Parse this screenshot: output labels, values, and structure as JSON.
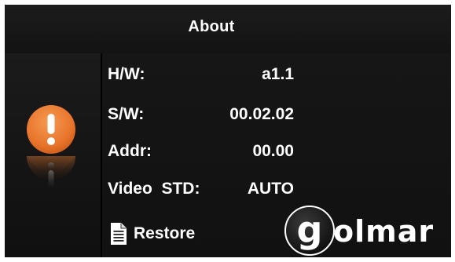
{
  "header": {
    "title": "About"
  },
  "info": {
    "rows": [
      {
        "label": "H/W:",
        "value": "a1.1"
      },
      {
        "label": "S/W:",
        "value": "00.02.02"
      },
      {
        "label": "Addr:",
        "value": "00.00"
      },
      {
        "label": "Video  STD:",
        "value": "AUTO"
      }
    ]
  },
  "actions": {
    "restore_label": "Restore"
  },
  "brand": {
    "logo_text": "golmar"
  },
  "icons": {
    "alert": "exclamation-icon",
    "restore": "document-icon"
  },
  "colors": {
    "alert_orange": "#e8742b",
    "text": "#ffffff",
    "background": "#000000"
  }
}
